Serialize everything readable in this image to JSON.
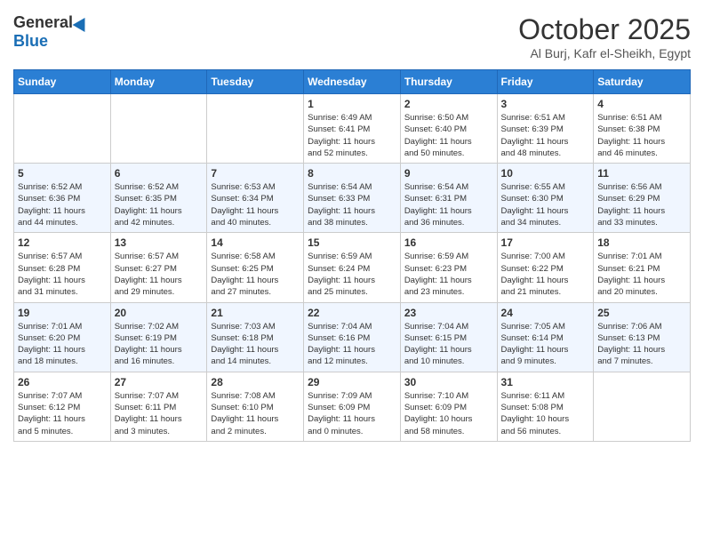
{
  "header": {
    "logo_general": "General",
    "logo_blue": "Blue",
    "month_title": "October 2025",
    "location": "Al Burj, Kafr el-Sheikh, Egypt"
  },
  "weekdays": [
    "Sunday",
    "Monday",
    "Tuesday",
    "Wednesday",
    "Thursday",
    "Friday",
    "Saturday"
  ],
  "weeks": [
    [
      {
        "day": "",
        "info": ""
      },
      {
        "day": "",
        "info": ""
      },
      {
        "day": "",
        "info": ""
      },
      {
        "day": "1",
        "info": "Sunrise: 6:49 AM\nSunset: 6:41 PM\nDaylight: 11 hours\nand 52 minutes."
      },
      {
        "day": "2",
        "info": "Sunrise: 6:50 AM\nSunset: 6:40 PM\nDaylight: 11 hours\nand 50 minutes."
      },
      {
        "day": "3",
        "info": "Sunrise: 6:51 AM\nSunset: 6:39 PM\nDaylight: 11 hours\nand 48 minutes."
      },
      {
        "day": "4",
        "info": "Sunrise: 6:51 AM\nSunset: 6:38 PM\nDaylight: 11 hours\nand 46 minutes."
      }
    ],
    [
      {
        "day": "5",
        "info": "Sunrise: 6:52 AM\nSunset: 6:36 PM\nDaylight: 11 hours\nand 44 minutes."
      },
      {
        "day": "6",
        "info": "Sunrise: 6:52 AM\nSunset: 6:35 PM\nDaylight: 11 hours\nand 42 minutes."
      },
      {
        "day": "7",
        "info": "Sunrise: 6:53 AM\nSunset: 6:34 PM\nDaylight: 11 hours\nand 40 minutes."
      },
      {
        "day": "8",
        "info": "Sunrise: 6:54 AM\nSunset: 6:33 PM\nDaylight: 11 hours\nand 38 minutes."
      },
      {
        "day": "9",
        "info": "Sunrise: 6:54 AM\nSunset: 6:31 PM\nDaylight: 11 hours\nand 36 minutes."
      },
      {
        "day": "10",
        "info": "Sunrise: 6:55 AM\nSunset: 6:30 PM\nDaylight: 11 hours\nand 34 minutes."
      },
      {
        "day": "11",
        "info": "Sunrise: 6:56 AM\nSunset: 6:29 PM\nDaylight: 11 hours\nand 33 minutes."
      }
    ],
    [
      {
        "day": "12",
        "info": "Sunrise: 6:57 AM\nSunset: 6:28 PM\nDaylight: 11 hours\nand 31 minutes."
      },
      {
        "day": "13",
        "info": "Sunrise: 6:57 AM\nSunset: 6:27 PM\nDaylight: 11 hours\nand 29 minutes."
      },
      {
        "day": "14",
        "info": "Sunrise: 6:58 AM\nSunset: 6:25 PM\nDaylight: 11 hours\nand 27 minutes."
      },
      {
        "day": "15",
        "info": "Sunrise: 6:59 AM\nSunset: 6:24 PM\nDaylight: 11 hours\nand 25 minutes."
      },
      {
        "day": "16",
        "info": "Sunrise: 6:59 AM\nSunset: 6:23 PM\nDaylight: 11 hours\nand 23 minutes."
      },
      {
        "day": "17",
        "info": "Sunrise: 7:00 AM\nSunset: 6:22 PM\nDaylight: 11 hours\nand 21 minutes."
      },
      {
        "day": "18",
        "info": "Sunrise: 7:01 AM\nSunset: 6:21 PM\nDaylight: 11 hours\nand 20 minutes."
      }
    ],
    [
      {
        "day": "19",
        "info": "Sunrise: 7:01 AM\nSunset: 6:20 PM\nDaylight: 11 hours\nand 18 minutes."
      },
      {
        "day": "20",
        "info": "Sunrise: 7:02 AM\nSunset: 6:19 PM\nDaylight: 11 hours\nand 16 minutes."
      },
      {
        "day": "21",
        "info": "Sunrise: 7:03 AM\nSunset: 6:18 PM\nDaylight: 11 hours\nand 14 minutes."
      },
      {
        "day": "22",
        "info": "Sunrise: 7:04 AM\nSunset: 6:16 PM\nDaylight: 11 hours\nand 12 minutes."
      },
      {
        "day": "23",
        "info": "Sunrise: 7:04 AM\nSunset: 6:15 PM\nDaylight: 11 hours\nand 10 minutes."
      },
      {
        "day": "24",
        "info": "Sunrise: 7:05 AM\nSunset: 6:14 PM\nDaylight: 11 hours\nand 9 minutes."
      },
      {
        "day": "25",
        "info": "Sunrise: 7:06 AM\nSunset: 6:13 PM\nDaylight: 11 hours\nand 7 minutes."
      }
    ],
    [
      {
        "day": "26",
        "info": "Sunrise: 7:07 AM\nSunset: 6:12 PM\nDaylight: 11 hours\nand 5 minutes."
      },
      {
        "day": "27",
        "info": "Sunrise: 7:07 AM\nSunset: 6:11 PM\nDaylight: 11 hours\nand 3 minutes."
      },
      {
        "day": "28",
        "info": "Sunrise: 7:08 AM\nSunset: 6:10 PM\nDaylight: 11 hours\nand 2 minutes."
      },
      {
        "day": "29",
        "info": "Sunrise: 7:09 AM\nSunset: 6:09 PM\nDaylight: 11 hours\nand 0 minutes."
      },
      {
        "day": "30",
        "info": "Sunrise: 7:10 AM\nSunset: 6:09 PM\nDaylight: 10 hours\nand 58 minutes."
      },
      {
        "day": "31",
        "info": "Sunrise: 6:11 AM\nSunset: 5:08 PM\nDaylight: 10 hours\nand 56 minutes."
      },
      {
        "day": "",
        "info": ""
      }
    ]
  ]
}
